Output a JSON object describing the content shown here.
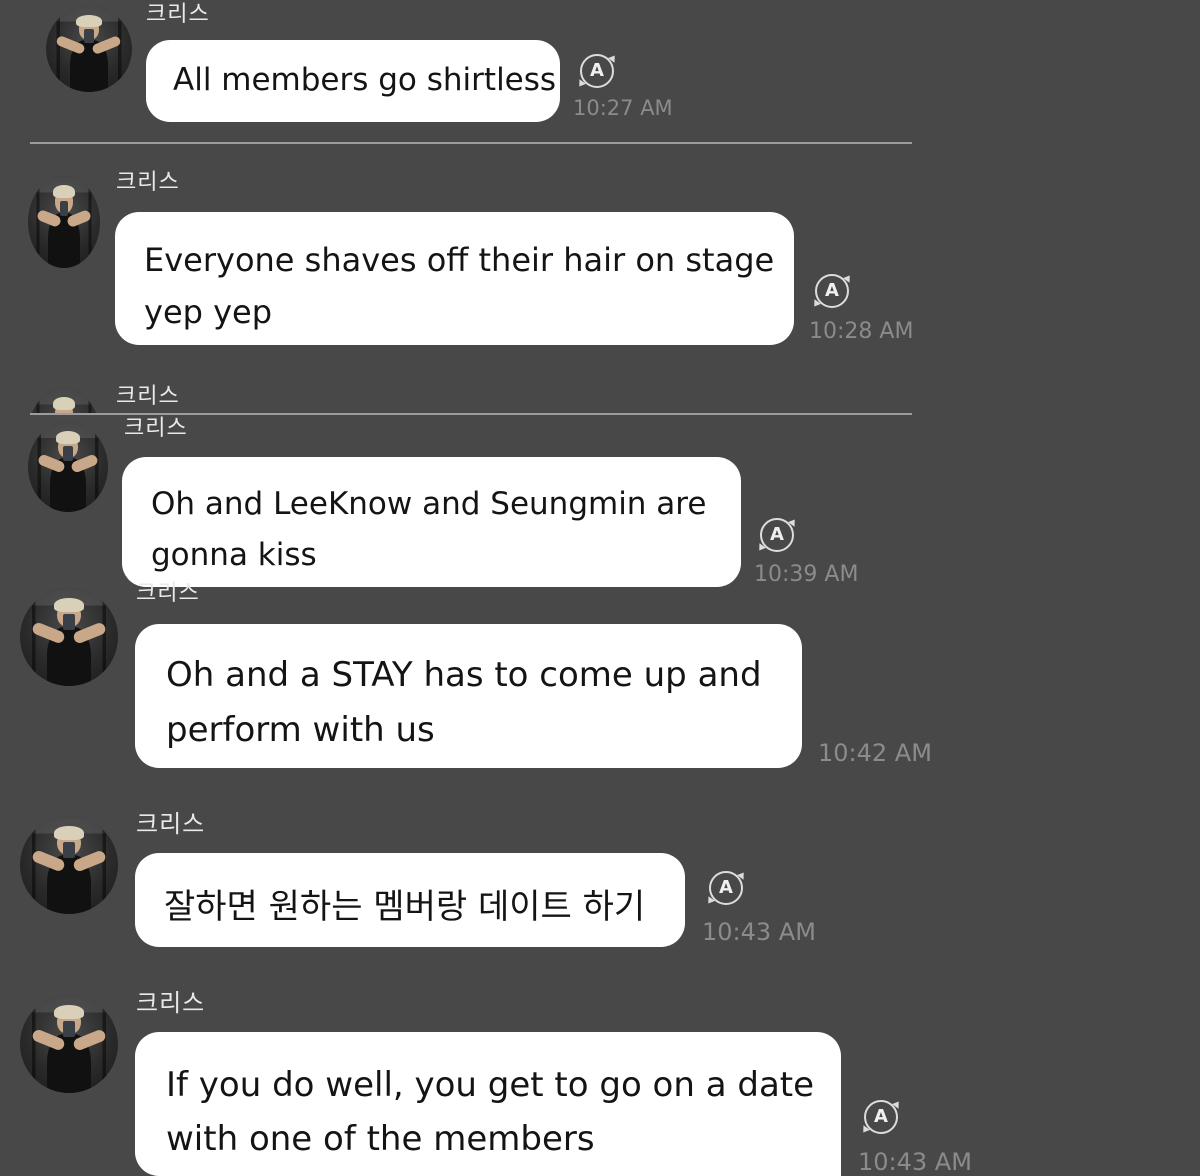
{
  "sender": "크리스",
  "translate_icon_glyph": "A",
  "messages": [
    {
      "text_lines": [
        "All members go shirtless"
      ],
      "time": "10:27 AM"
    },
    {
      "text_lines": [
        "Everyone shaves off their hair on stage",
        "yep yep"
      ],
      "time": "10:28 AM"
    },
    {
      "text_lines": [
        "Oh and LeeKnow and Seungmin are",
        "gonna kiss"
      ],
      "time": "10:39 AM"
    },
    {
      "text_lines": [
        "Oh and a STAY has to come up and",
        "perform with us"
      ],
      "time": "10:42 AM"
    },
    {
      "text_lines": [
        "잘하면 원하는 멤버랑 데이트 하기"
      ],
      "time": "10:43 AM"
    },
    {
      "text_lines": [
        "If you do well, you get to go on a date",
        "with one of the members"
      ],
      "time": "10:43 AM"
    }
  ],
  "colors": {
    "background": "#484848",
    "bubble": "#ffffff",
    "message_text": "#141414",
    "name_text": "#e9e9e9",
    "timestamp": "#8b8b8b",
    "divider": "#9c9c9c"
  },
  "icons": {
    "avatar": "profile-photo",
    "translate": "translate-a-icon"
  }
}
